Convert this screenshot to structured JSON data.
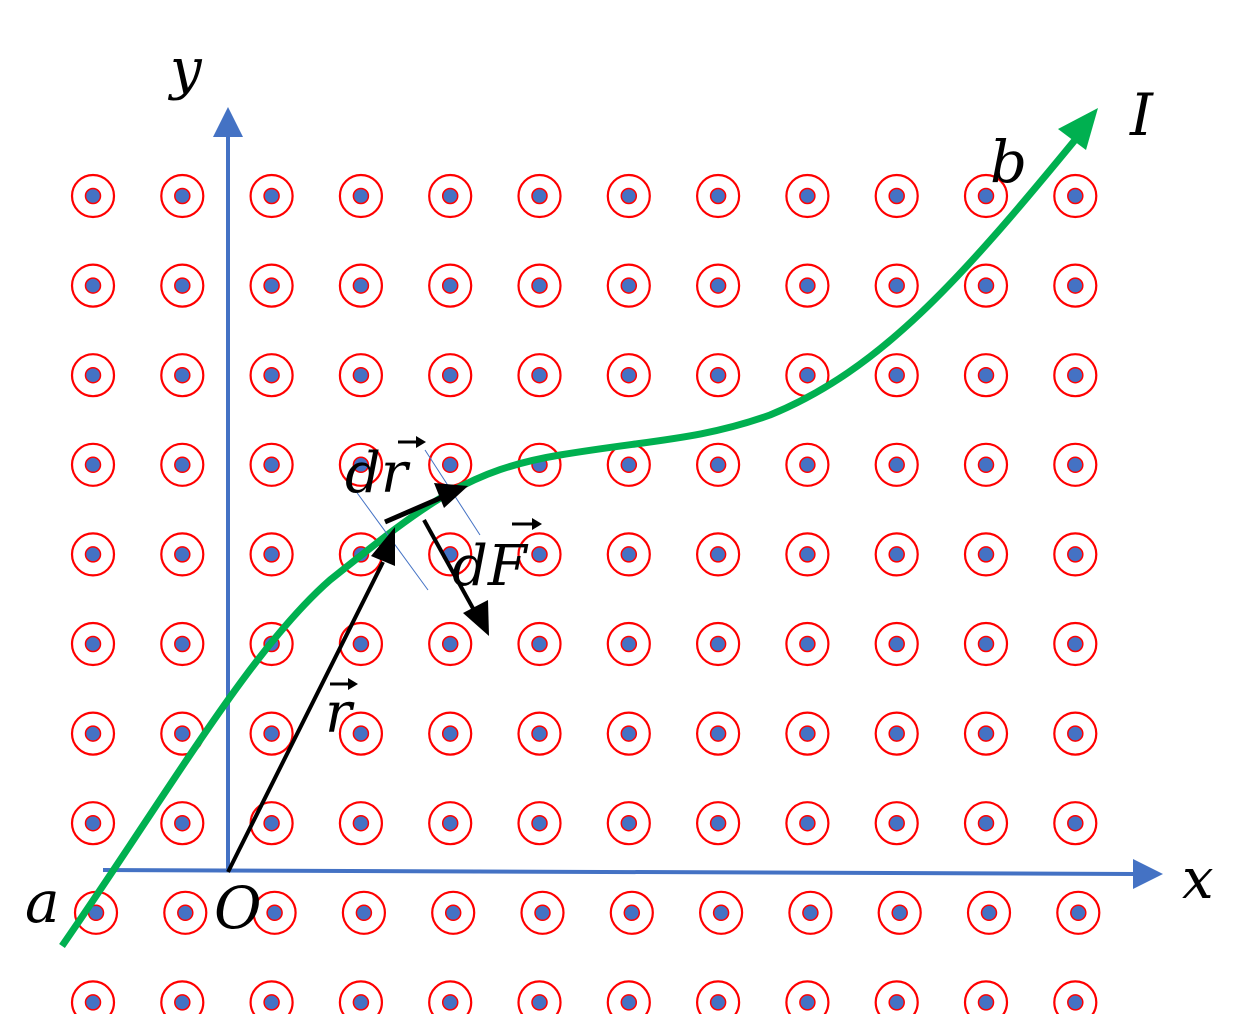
{
  "labels": {
    "y_axis": "y",
    "x_axis": "x",
    "origin": "O",
    "point_a": "a",
    "point_b": "b",
    "current": "I",
    "position_vector": "r",
    "line_element": "dr",
    "force_element": "dF"
  },
  "field": {
    "symbol": "dot-in-circle",
    "direction": "out of page",
    "rows": 10,
    "cols": 12
  },
  "colors": {
    "axes": "#4472C4",
    "wire": "#00B050",
    "field_ring": "#FF0000",
    "field_dot": "#4472C4",
    "vectors": "#000000"
  }
}
